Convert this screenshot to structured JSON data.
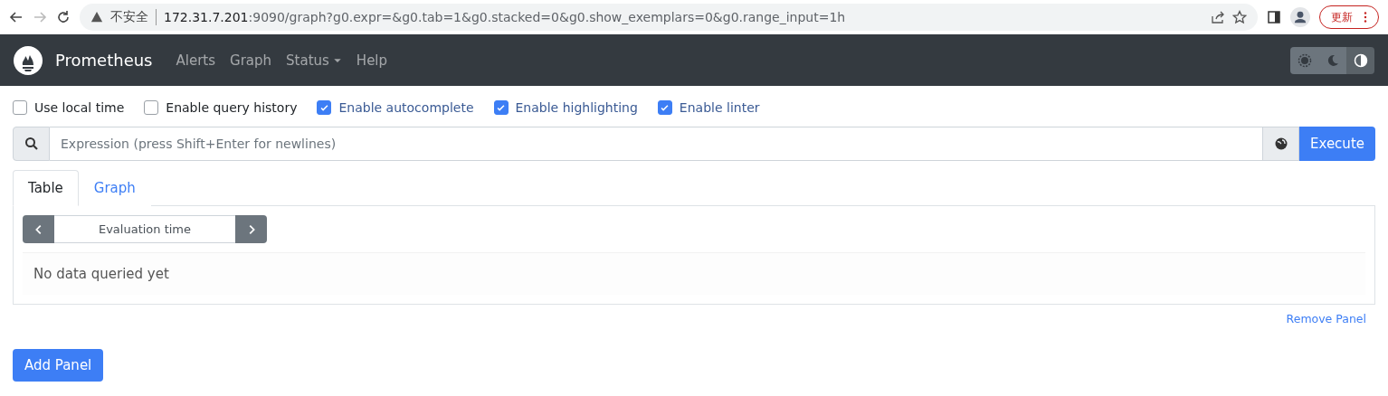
{
  "browser": {
    "security_label": "不安全",
    "url_host": "172.31.7.201",
    "url_rest": ":9090/graph?g0.expr=&g0.tab=1&g0.stacked=0&g0.show_exemplars=0&g0.range_input=1h",
    "update_button": "更新"
  },
  "navbar": {
    "brand": "Prometheus",
    "links": [
      {
        "label": "Alerts",
        "kind": "link"
      },
      {
        "label": "Graph",
        "kind": "link"
      },
      {
        "label": "Status",
        "kind": "dropdown"
      },
      {
        "label": "Help",
        "kind": "link"
      }
    ],
    "theme": [
      {
        "kind": "light",
        "selected": false
      },
      {
        "kind": "dark",
        "selected": false
      },
      {
        "kind": "auto",
        "selected": true
      }
    ]
  },
  "options": [
    {
      "label": "Use local time",
      "checked": false
    },
    {
      "label": "Enable query history",
      "checked": false
    },
    {
      "label": "Enable autocomplete",
      "checked": true
    },
    {
      "label": "Enable highlighting",
      "checked": true
    },
    {
      "label": "Enable linter",
      "checked": true
    }
  ],
  "query": {
    "placeholder": "Expression (press Shift+Enter for newlines)",
    "execute": "Execute"
  },
  "panel": {
    "tabs": [
      {
        "label": "Table",
        "selected": true
      },
      {
        "label": "Graph",
        "selected": false
      }
    ],
    "evaluation_time_placeholder": "Evaluation time",
    "empty_message": "No data queried yet",
    "remove": "Remove Panel"
  },
  "add_panel": "Add Panel"
}
